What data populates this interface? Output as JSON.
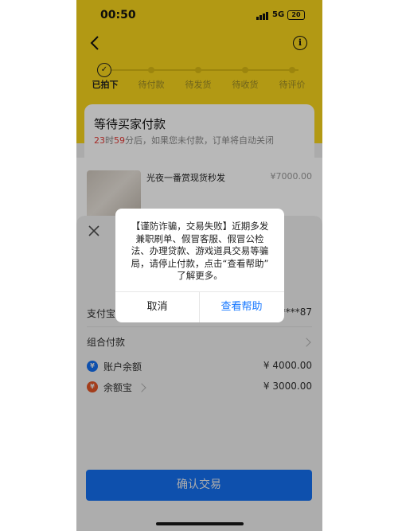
{
  "status_bar": {
    "time": "00:50",
    "network": "5G",
    "battery": "20"
  },
  "steps": [
    {
      "label": "已拍下",
      "state": "done"
    },
    {
      "label": "待付款",
      "state": "pending"
    },
    {
      "label": "待发货",
      "state": "pending"
    },
    {
      "label": "待收货",
      "state": "pending"
    },
    {
      "label": "待评价",
      "state": "pending"
    }
  ],
  "order_card": {
    "title": "等待买家付款",
    "hours": "23",
    "hours_unit": "时",
    "minutes": "59",
    "suffix": "分后，如果您未付款，订单将自动关闭"
  },
  "product": {
    "name": "光夜一番赏现货秒发",
    "price": "¥7000.00"
  },
  "payment_sheet": {
    "method_label": "支付宝",
    "account_suffix": "****87",
    "combo_label": "组合付款",
    "balance_label": "账户余额",
    "balance_amount": "¥ 4000.00",
    "yuebao_label": "余额宝",
    "yuebao_amount": "¥ 3000.00",
    "confirm_label": "确认交易"
  },
  "dialog": {
    "line1": "【谨防诈骗，交易失败】近期多发",
    "line2": "兼职刷单、假冒客服、假冒公检",
    "line3": "法、办理贷款、游戏道具交易等骗",
    "line4": "局，请停止付款，点击“查看帮助”",
    "line5": "了解更多。",
    "cancel_label": "取消",
    "help_label": "查看帮助"
  },
  "colors": {
    "header": "#f7d51d",
    "accent": "#1677ff",
    "countdown": "#e53935"
  }
}
